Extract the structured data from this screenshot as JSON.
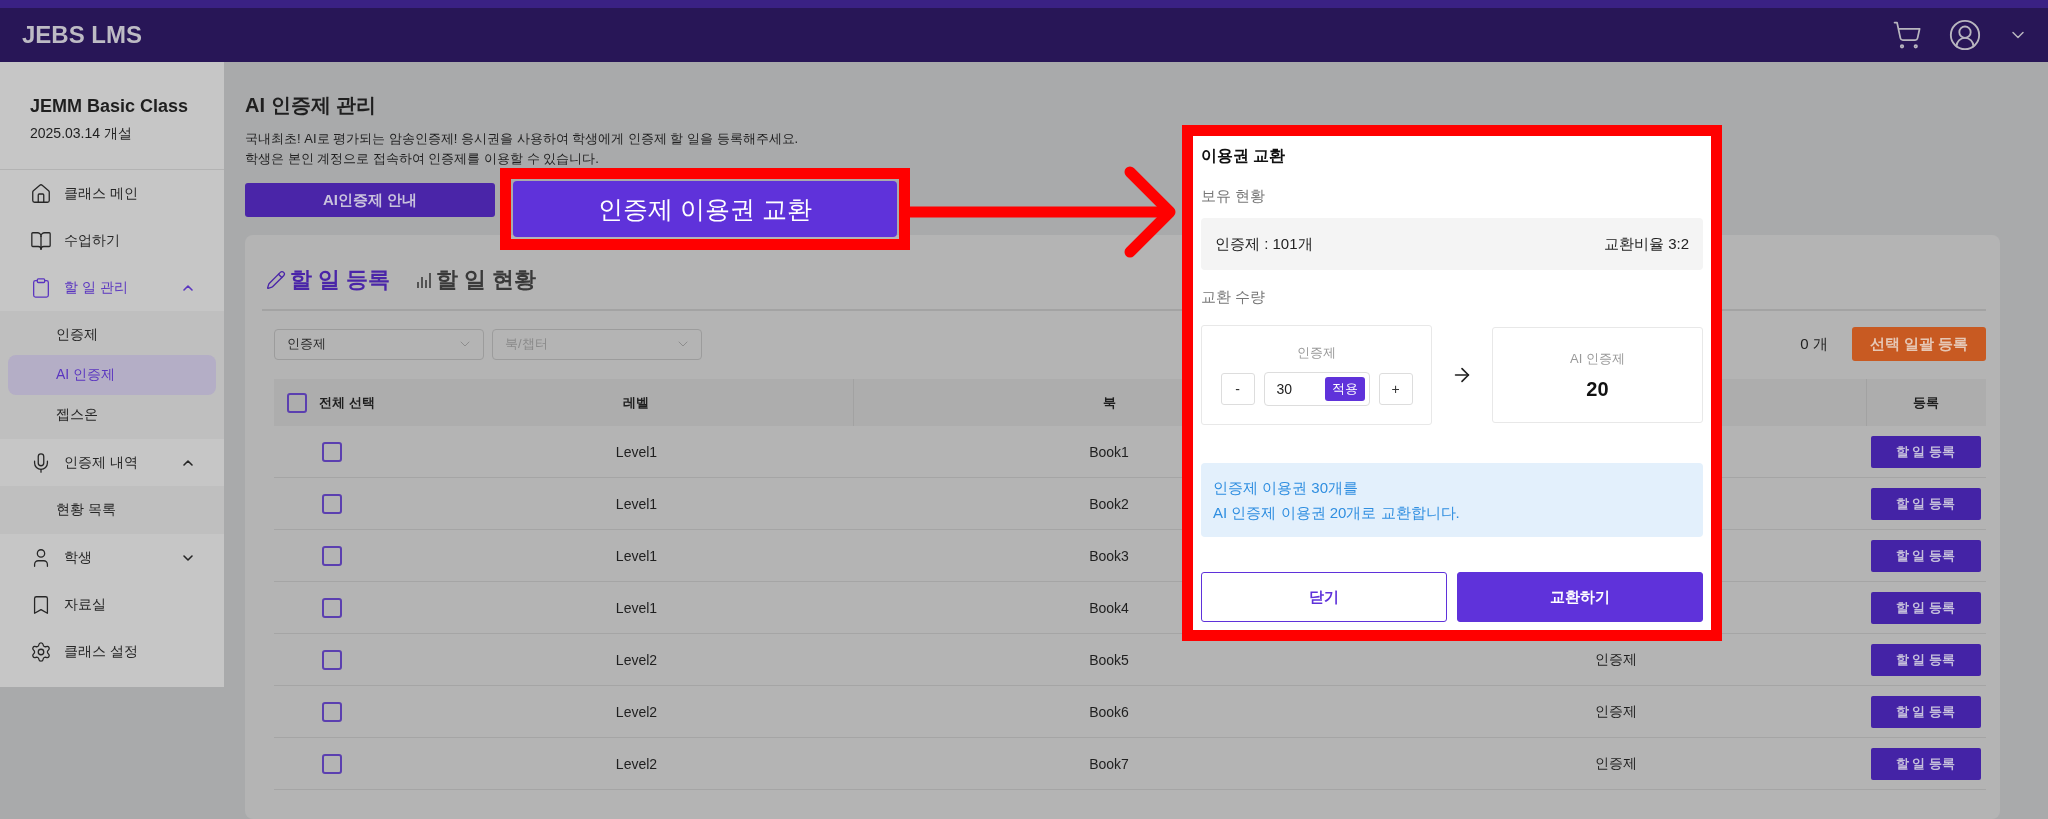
{
  "header": {
    "logo": "JEBS LMS"
  },
  "sidebar": {
    "class_name": "JEMM Basic Class",
    "opened": "2025.03.14 개설",
    "items": [
      {
        "label": "클래스 메인",
        "selected": false
      },
      {
        "label": "수업하기",
        "selected": false
      },
      {
        "label": "할 일 관리",
        "selected": true,
        "expanded": true,
        "children": [
          {
            "label": "인증제",
            "selected": false
          },
          {
            "label": "AI 인증제",
            "selected": true
          },
          {
            "label": "젭스온",
            "selected": false
          }
        ]
      },
      {
        "label": "인증제 내역",
        "selected": false,
        "expanded": true,
        "children": [
          {
            "label": "현황 목록",
            "selected": false
          }
        ]
      },
      {
        "label": "학생",
        "selected": false,
        "expanded": false
      },
      {
        "label": "자료실",
        "selected": false
      },
      {
        "label": "클래스 설정",
        "selected": false
      }
    ]
  },
  "page": {
    "title": "AI 인증제 관리",
    "description": [
      "국내최초! AI로 평가되는 암송인증제! 응시권을 사용하여 학생에게 인증제 할 일을 등록해주세요.",
      "학생은 본인 계정으로 접속하여 인증제를 이용할 수 있습니다."
    ],
    "buttons": [
      "AI인증제 안내"
    ],
    "callout": {
      "label": "인증제 이용권 교환"
    }
  },
  "tabs": [
    {
      "label": "할 일 등록",
      "selected": true
    },
    {
      "label": "할 일 현황",
      "selected": false
    }
  ],
  "filters": [
    {
      "value": "인증제"
    },
    {
      "placeholder": "북/챕터"
    }
  ],
  "selected_count": "0 개",
  "bulk_button": "선택 일괄 등록",
  "table": {
    "select_all": {
      "label": "전체 선택",
      "checked": false
    },
    "level": "레벨",
    "book": "북",
    "register": "등록",
    "rows": [
      {
        "checked": false,
        "level": "Level1",
        "book": "Book1",
        "button": "할 일 등록"
      },
      {
        "checked": false,
        "level": "Level1",
        "book": "Book2",
        "button": "할 일 등록"
      },
      {
        "checked": false,
        "level": "Level1",
        "book": "Book3",
        "button": "할 일 등록"
      },
      {
        "checked": false,
        "level": "Level1",
        "book": "Book4",
        "button": "할 일 등록"
      },
      {
        "checked": false,
        "level": "Level2",
        "book": "Book5",
        "column_4": "인증제",
        "button": "할 일 등록"
      },
      {
        "checked": false,
        "level": "Level2",
        "book": "Book6",
        "column_4": "인증제",
        "button": "할 일 등록"
      },
      {
        "checked": false,
        "level": "Level2",
        "book": "Book7",
        "column_4": "인증제",
        "button": "할 일 등록"
      }
    ]
  },
  "modal": {
    "title": "이용권 교환",
    "holdings_label": "보유 현황",
    "holdings": {
      "count": "인증제 : 101개",
      "ratio": "교환비율 3:2"
    },
    "amount_label": "교환 수량",
    "from": {
      "label": "인증제",
      "minus": "-",
      "value": "30",
      "apply": "적용",
      "plus": "+"
    },
    "to": {
      "label": "AI 인증제",
      "value": "20"
    },
    "notice": [
      "인증제 이용권 30개를",
      "AI 인증제 이용권 20개로 교환합니다."
    ],
    "buttons": [
      {
        "label": "닫기",
        "kind": "secondary"
      },
      {
        "label": "교환하기",
        "kind": "primary"
      }
    ]
  }
}
